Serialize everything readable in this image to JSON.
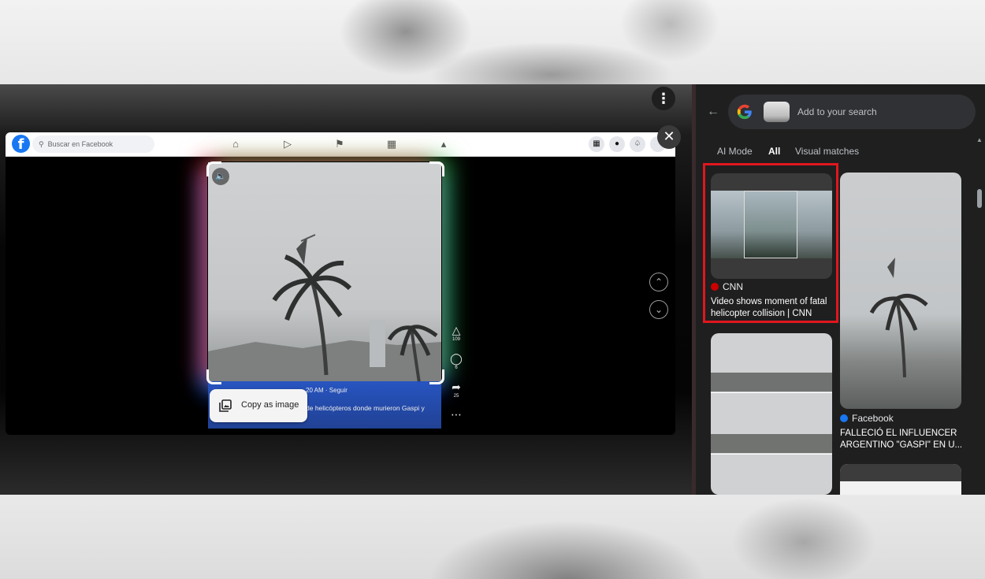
{
  "facebook": {
    "search_placeholder": "Buscar en Facebook",
    "post": {
      "meta": "20 AM · Seguir",
      "caption": "de helicópteros donde murieron Gaspi y",
      "likes": "109",
      "comments": "6",
      "shares": "25"
    }
  },
  "lens": {
    "copy_image_label": "Copy as image"
  },
  "search_panel": {
    "placeholder": "Add to your search",
    "tabs": [
      {
        "label": "AI Mode",
        "active": false
      },
      {
        "label": "All",
        "active": true
      },
      {
        "label": "Visual matches",
        "active": false
      }
    ],
    "results": [
      {
        "source": "CNN",
        "title": "Video shows moment of fatal helicopter collision | CNN",
        "highlighted": true
      },
      {
        "source": "Facebook",
        "title": "FALLECIÓ EL INFLUENCER ARGENTINO \"GASPI\" EN U..."
      }
    ]
  },
  "colors": {
    "highlight": "#e0161e",
    "facebook_blue": "#1877f2",
    "panel_bg": "#1f1f1f"
  }
}
